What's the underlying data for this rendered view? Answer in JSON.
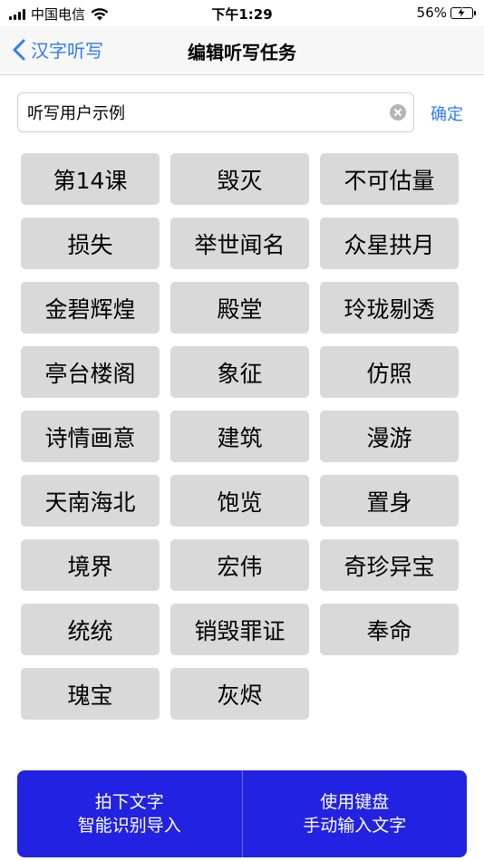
{
  "status_bar": {
    "carrier": "中国电信",
    "time": "下午1:29",
    "battery_percent": "56%",
    "battery_level": 56,
    "battery_color": "#34c759"
  },
  "nav": {
    "back_label": "汉字听写",
    "title": "编辑听写任务",
    "accent_color": "#2f7cf6"
  },
  "search": {
    "value": "听写用户示例",
    "confirm_label": "确定"
  },
  "words": [
    "第14课",
    "毁灭",
    "不可估量",
    "损失",
    "举世闻名",
    "众星拱月",
    "金碧辉煌",
    "殿堂",
    "玲珑剔透",
    "亭台楼阁",
    "象征",
    "仿照",
    "诗情画意",
    "建筑",
    "漫游",
    "天南海北",
    "饱览",
    "置身",
    "境界",
    "宏伟",
    "奇珍异宝",
    "统统",
    "销毁罪证",
    "奉命",
    "瑰宝",
    "灰烬"
  ],
  "bottom": {
    "left_line1": "拍下文字",
    "left_line2": "智能识别导入",
    "right_line1": "使用键盘",
    "right_line2": "手动输入文字",
    "color": "#2222e3"
  }
}
